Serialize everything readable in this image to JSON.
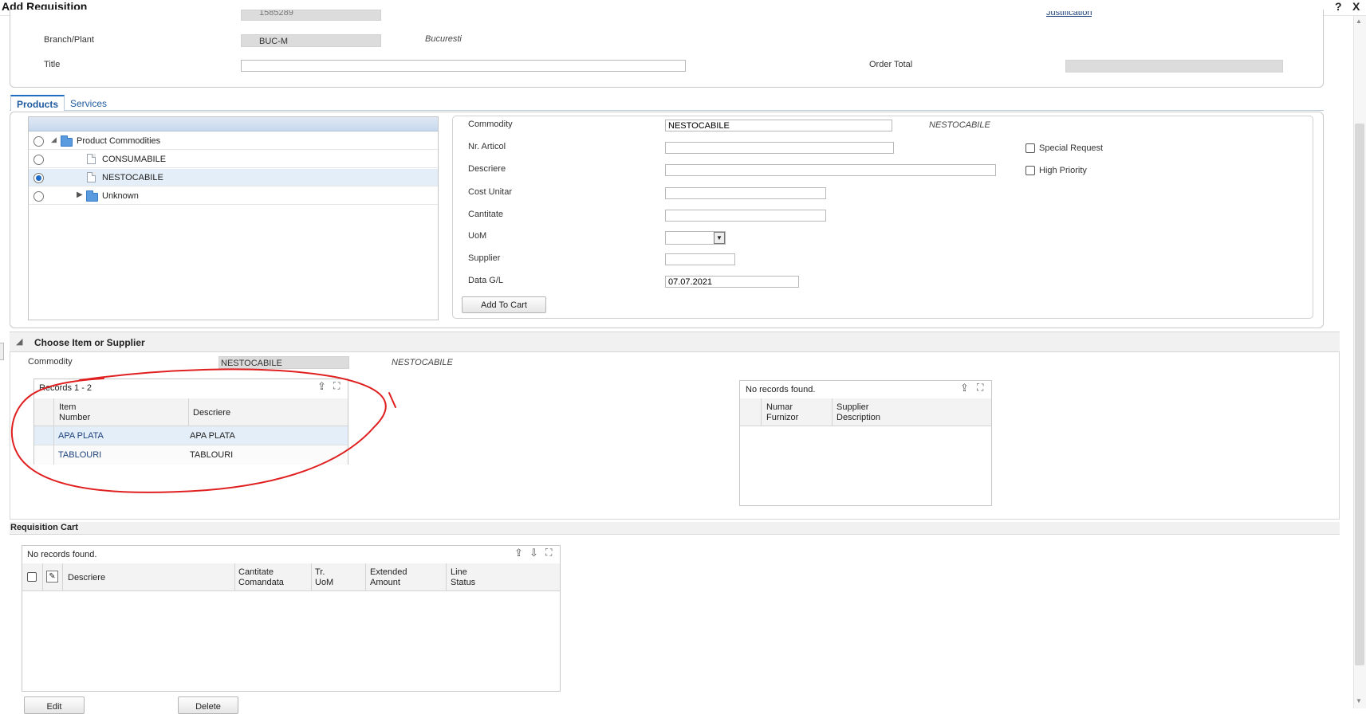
{
  "window": {
    "title": "Add Requisition",
    "help_icon": "?",
    "close_icon": "X"
  },
  "header": {
    "top_partial_value": "1585289",
    "justification_link": "Justification",
    "branch_label": "Branch/Plant",
    "branch_value": "BUC-M",
    "branch_desc": "Bucuresti",
    "title_label": "Title",
    "title_value": "",
    "order_total_label": "Order Total",
    "order_total_value": ""
  },
  "tabs": [
    {
      "label": "Products",
      "active": true
    },
    {
      "label": "Services",
      "active": false
    }
  ],
  "tree": {
    "items": [
      {
        "label": "Product Commodities",
        "level": 0,
        "type": "folder",
        "expanded": true,
        "selected": false
      },
      {
        "label": "CONSUMABILE",
        "level": 1,
        "type": "doc",
        "selected": false
      },
      {
        "label": "NESTOCABILE",
        "level": 1,
        "type": "doc",
        "selected": true
      },
      {
        "label": "Unknown",
        "level": 1,
        "type": "folder",
        "expanded": false,
        "selected": false
      }
    ]
  },
  "form": {
    "commodity_label": "Commodity",
    "commodity_value": "NESTOCABILE",
    "commodity_desc": "NESTOCABILE",
    "nr_articol_label": "Nr. Articol",
    "nr_articol_value": "",
    "descriere_label": "Descriere",
    "descriere_value": "",
    "cost_label": "Cost Unitar",
    "cost_value": "",
    "cantitate_label": "Cantitate",
    "cantitate_value": "",
    "uom_label": "UoM",
    "uom_value": "",
    "supplier_label": "Supplier",
    "supplier_value": "",
    "data_label": "Data G/L",
    "data_value": "07.07.2021",
    "special_request_label": "Special Request",
    "high_priority_label": "High Priority",
    "add_to_cart_label": "Add To Cart"
  },
  "choose": {
    "title": "Choose Item or Supplier",
    "commodity_label": "Commodity",
    "commodity_value": "NESTOCABILE",
    "commodity_desc": "NESTOCABILE",
    "items_grid": {
      "records": "Records 1 - 2",
      "headers": [
        "Item Number",
        "Descriere"
      ],
      "header_lines": [
        [
          "Item",
          "Number"
        ],
        [
          "Descriere"
        ]
      ],
      "rows": [
        {
          "item": "APA PLATA",
          "descriere": "APA PLATA"
        },
        {
          "item": "TABLOURI",
          "descriere": "TABLOURI"
        }
      ]
    },
    "supplier_grid": {
      "records": "No records found.",
      "header_lines": [
        [
          "Numar",
          "Furnizor"
        ],
        [
          "Supplier",
          "Description"
        ]
      ]
    }
  },
  "cart": {
    "title": "Requisition Cart",
    "records": "No records found.",
    "header_lines": [
      [
        "Descriere"
      ],
      [
        "Cantitate",
        "Comandata"
      ],
      [
        "Tr.",
        "UoM"
      ],
      [
        "Extended",
        "Amount"
      ],
      [
        "Line",
        "Status"
      ]
    ],
    "edit_label": "Edit",
    "delete_label": "Delete"
  },
  "annotation": {
    "color": "#e02020",
    "shape": "hand-drawn red circle around items grid"
  }
}
